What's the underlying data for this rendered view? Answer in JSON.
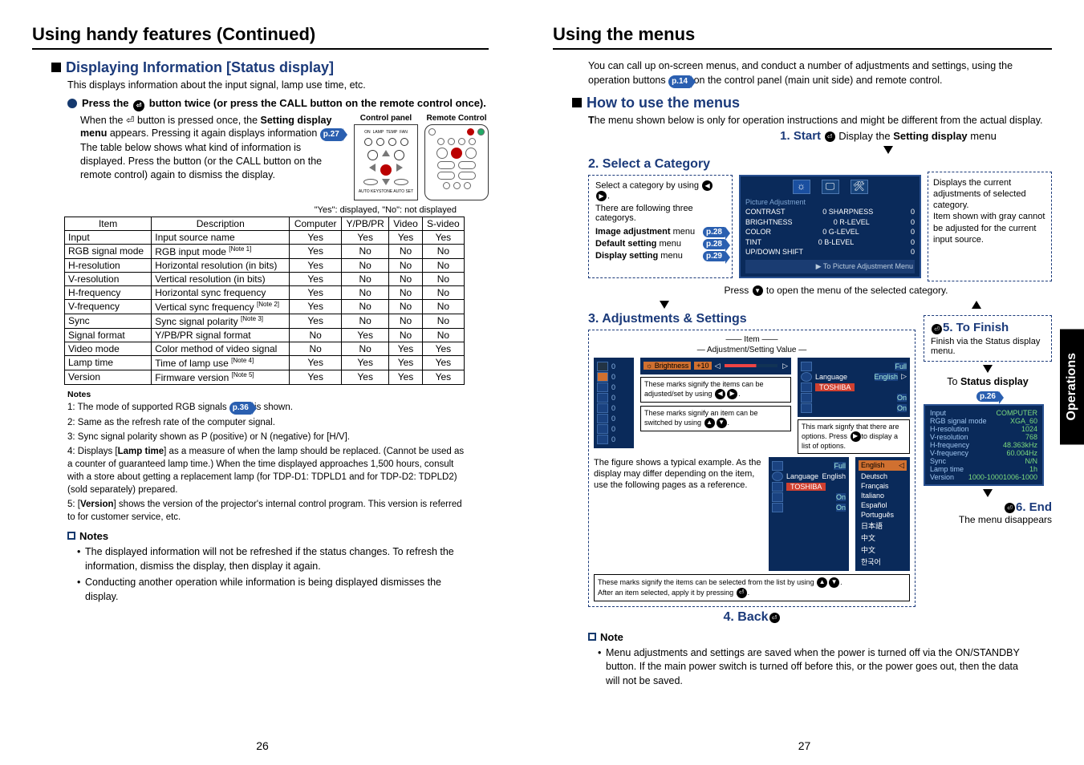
{
  "left": {
    "h1": "Using handy features (Continued)",
    "h2": "Displaying Information [Status display]",
    "intro": "This displays information about the input signal, lamp use time, etc.",
    "step_pre": "Press the ",
    "step_post": " button twice (or press the CALL button on the remote control once).",
    "body1a": "When the ",
    "body1b": " button is pressed once, the ",
    "body1c": "Setting display menu",
    "body1d": " appears. Pressing it again displays information ",
    "body1e": ". The table below shows what kind of information is displayed. Press the button (or the CALL button on the remote control) again to dismiss the display.",
    "pref27": "p.27",
    "cap_panel": "Control panel",
    "cap_remote": "Remote Control",
    "panel_leds": [
      "ON",
      "LAMP",
      "TEMP",
      "FAN"
    ],
    "panel_foot": "AUTO KEYSTONE       AUTO SET",
    "yesno": "\"Yes\": displayed, \"No\": not displayed",
    "thead": [
      "Item",
      "Description",
      "Computer",
      "Y/PB/PR",
      "Video",
      "S-video"
    ],
    "rows": [
      [
        "Input",
        "Input source name",
        "Yes",
        "Yes",
        "Yes",
        "Yes"
      ],
      [
        "RGB signal mode",
        "RGB input mode [Note 1]",
        "Yes",
        "No",
        "No",
        "No"
      ],
      [
        "H-resolution",
        "Horizontal resolution (in bits)",
        "Yes",
        "No",
        "No",
        "No"
      ],
      [
        "V-resolution",
        "Vertical resolution (in bits)",
        "Yes",
        "No",
        "No",
        "No"
      ],
      [
        "H-frequency",
        "Horizontal sync frequency",
        "Yes",
        "No",
        "No",
        "No"
      ],
      [
        "V-frequency",
        "Vertical sync frequency [Note 2]",
        "Yes",
        "No",
        "No",
        "No"
      ],
      [
        "Sync",
        "Sync signal polarity [Note 3]",
        "Yes",
        "No",
        "No",
        "No"
      ],
      [
        "Signal format",
        "Y/PB/PR signal format",
        "No",
        "Yes",
        "No",
        "No"
      ],
      [
        "Video mode",
        "Color method of video signal",
        "No",
        "No",
        "Yes",
        "Yes"
      ],
      [
        "Lamp time",
        "Time of lamp use [Note 4]",
        "Yes",
        "Yes",
        "Yes",
        "Yes"
      ],
      [
        "Version",
        "Firmware version [Note 5]",
        "Yes",
        "Yes",
        "Yes",
        "Yes"
      ]
    ],
    "notes_h": "Notes",
    "pref36": "p.36",
    "notes": [
      "1: The mode of supported RGB signals __P36__ is shown.",
      "2: Same as the refresh rate of the computer signal.",
      "3: Sync signal polarity shown as P (positive) or N (negative) for [H/V].",
      "4: Displays [Lamp time] as a measure of when the lamp should be replaced. (Cannot be used as a counter of guaranteed lamp time.) When the time displayed approaches 1,500 hours, consult with a store about getting a replacement lamp (for TDP-D1: TDPLD1 and for TDP-D2: TDPLD2) (sold separately) prepared.",
      "5: [Version] shows the version of the projector's internal control program. This version is referred to for customer service, etc."
    ],
    "notes2_h": "Notes",
    "notes2": [
      "The displayed information will not be refreshed if the status changes. To refresh the information, dismiss the display, then display it again.",
      "Conducting another operation while information is being displayed dismisses the display."
    ],
    "page": "26"
  },
  "right": {
    "h1": "Using the menus",
    "intro_a": "You can call up on-screen menus, and conduct a number of adjustments and settings, using the operation buttons ",
    "intro_b": " on the control panel (main unit side) and remote control.",
    "pref14": "p.14",
    "h2": "How to use the menus",
    "h2desc": "The menu shown below is only for operation instructions and might be different from the actual display.",
    "s1": "1. Start",
    "s1txt_a": " Display the ",
    "s1txt_b": "Setting display",
    "s1txt_c": " menu",
    "s2": "2. Select a Category",
    "s2box_a": "Select a category by using ",
    "s2box_b": ".",
    "s2box_c": "There are following three categorys.",
    "s2m1": "Image adjustment",
    "s2m1b": " menu",
    "s2m2": "Default setting",
    "s2m3": "Display setting",
    "p28": "p.28",
    "p29": "p.29",
    "s2right": "Displays the current adjustments of selected category.\nItem shown with gray cannot be adjusted for the current input source.",
    "menu_title": "Picture Adjustment",
    "menu_rows": [
      [
        "CONTRAST",
        "0",
        "SHARPNESS",
        "0"
      ],
      [
        "BRIGHTNESS",
        "0",
        "R-LEVEL",
        "0"
      ],
      [
        "COLOR",
        "0",
        "G-LEVEL",
        "0"
      ],
      [
        "TINT",
        "0",
        "B-LEVEL",
        "0"
      ],
      [
        "UP/DOWN SHIFT",
        "",
        "",
        "0"
      ]
    ],
    "menu_foot": "▶ To Picture Adjustment Menu",
    "mid_txt_a": "Press ",
    "mid_txt_b": " to open the menu of the selected category.",
    "s3": "3. Adjustments & Settings",
    "s3_item": "Item",
    "s3_val": "Adjustment/Setting Value",
    "s3_note1": "These marks signify the items can be adjusted/set by using ",
    "s3_note2": "These marks signify an item can be switched by using ",
    "s3_bright": "Brightness",
    "s3_bval": "+10",
    "s3_full": "Full",
    "s3_lang": "Language",
    "s3_eng": "English",
    "s3_on": "On",
    "s3_note3": "This mark signfy that there are options. Press ",
    "s3_note3b": "to display a list of options.",
    "opts": [
      "Deutsch",
      "Français",
      "Italiano",
      "Español",
      "Português",
      "日本語",
      "中文",
      "中文",
      "한국어"
    ],
    "s3_desc": "The figure shows a typical example. As the display may differ depending on the item, use the following pages as a reference.",
    "s3_bot_a": "These marks signify the items can be selected from the list by using ",
    "s3_bot_b": ".",
    "s3_bot_c": "After an item selected, apply it by pressing ",
    "s4": "4. Back",
    "s5": "5. To Finish",
    "s5txt": "Finish via the Status display menu.",
    "s5to": "To ",
    "s5sd": "Status display",
    "p26": "p.26",
    "status_labels": [
      "Input",
      "RGB signal mode",
      "H-resolution",
      "V-resolution",
      "H-frequency",
      "V-frequency",
      "Sync",
      "Lamp time",
      "Version"
    ],
    "status_vals": [
      "COMPUTER",
      "XGA_60",
      "1024",
      "768",
      "48.363kHz",
      "60.004Hz",
      "N/N",
      "1h",
      "1000-10001006-1000"
    ],
    "s6": "6. End",
    "s6txt": "The menu disappears",
    "note_h": "Note",
    "note": "Menu adjustments and settings are saved when the power is turned off via the ON/STANDBY button. If the main power switch is turned off before this, or the power goes out, then the data will not be saved.",
    "page": "27",
    "sidetab": "Operations"
  }
}
